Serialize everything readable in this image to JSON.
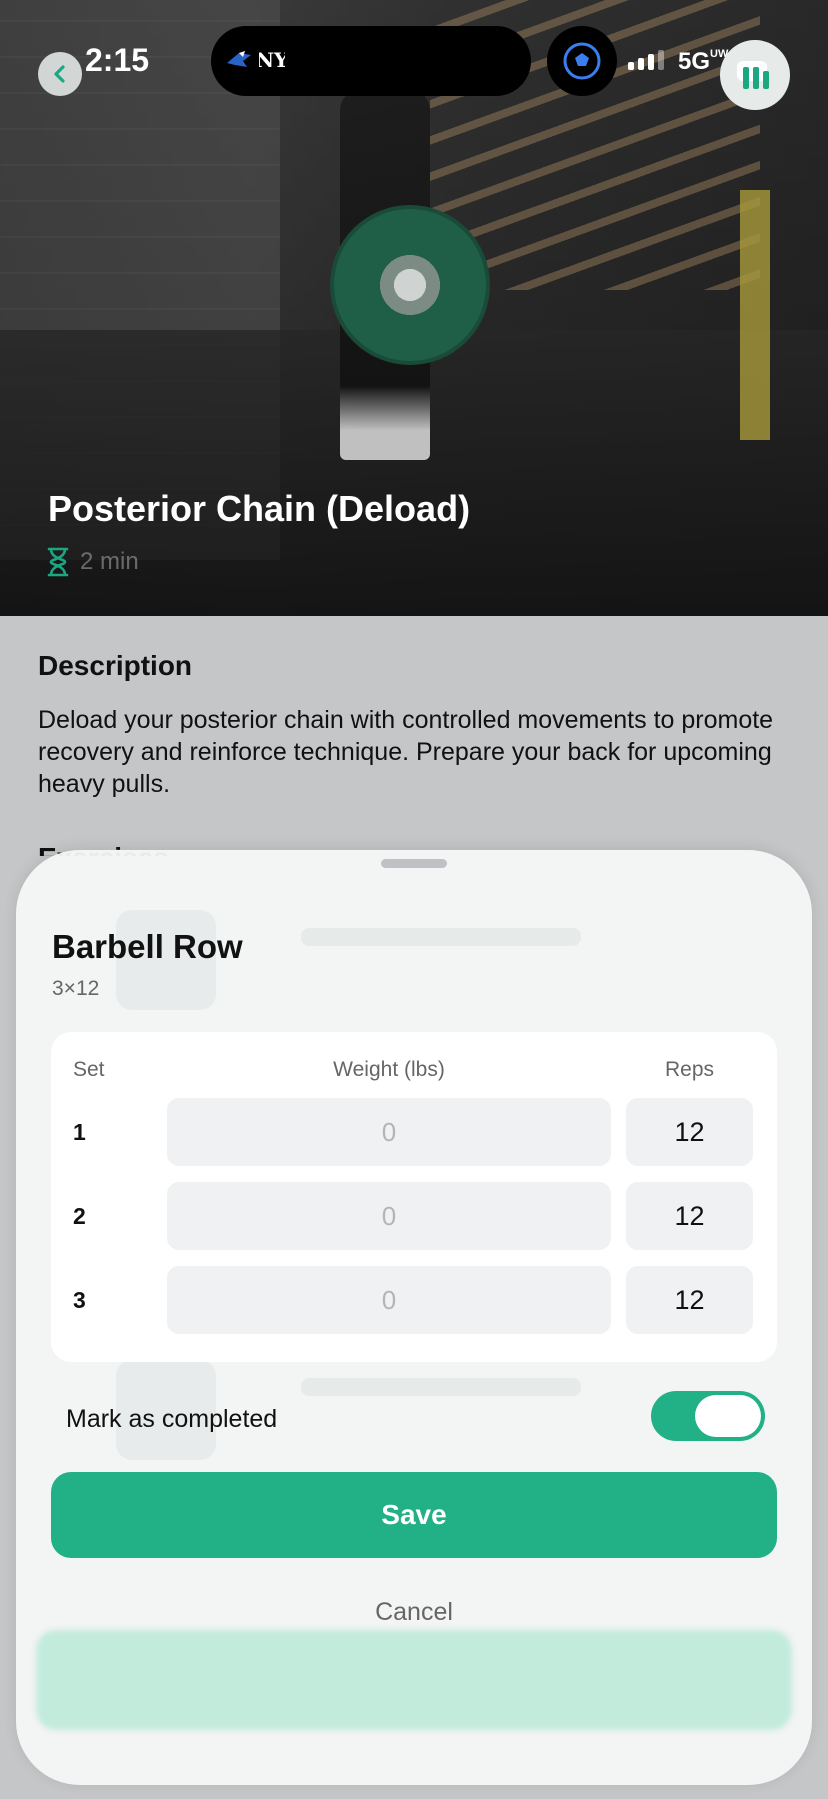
{
  "status_bar": {
    "time": "2:15",
    "network": "5G",
    "network_sub": "UW",
    "island_icons": [
      "blue-jays-logo-icon",
      "yankees-logo-icon"
    ]
  },
  "workout": {
    "title": "Posterior Chain (Deload)",
    "duration": "2 min"
  },
  "description": {
    "heading": "Description",
    "text": "Deload your posterior chain with controlled movements to promote recovery and reinforce technique. Prepare your back for upcoming heavy pulls."
  },
  "exercises_heading": "Exercises",
  "sheet": {
    "exercise_name": "Barbell Row",
    "scheme": "3×12",
    "columns": {
      "set": "Set",
      "weight": "Weight (lbs)",
      "reps": "Reps"
    },
    "sets": [
      {
        "set": "1",
        "weight_placeholder": "0",
        "reps": "12"
      },
      {
        "set": "2",
        "weight_placeholder": "0",
        "reps": "12"
      },
      {
        "set": "3",
        "weight_placeholder": "0",
        "reps": "12"
      }
    ],
    "mark_completed_label": "Mark as completed",
    "mark_completed_on": true,
    "save_label": "Save",
    "cancel_label": "Cancel"
  },
  "colors": {
    "accent": "#22b086",
    "accent_text": "#1aa781"
  }
}
